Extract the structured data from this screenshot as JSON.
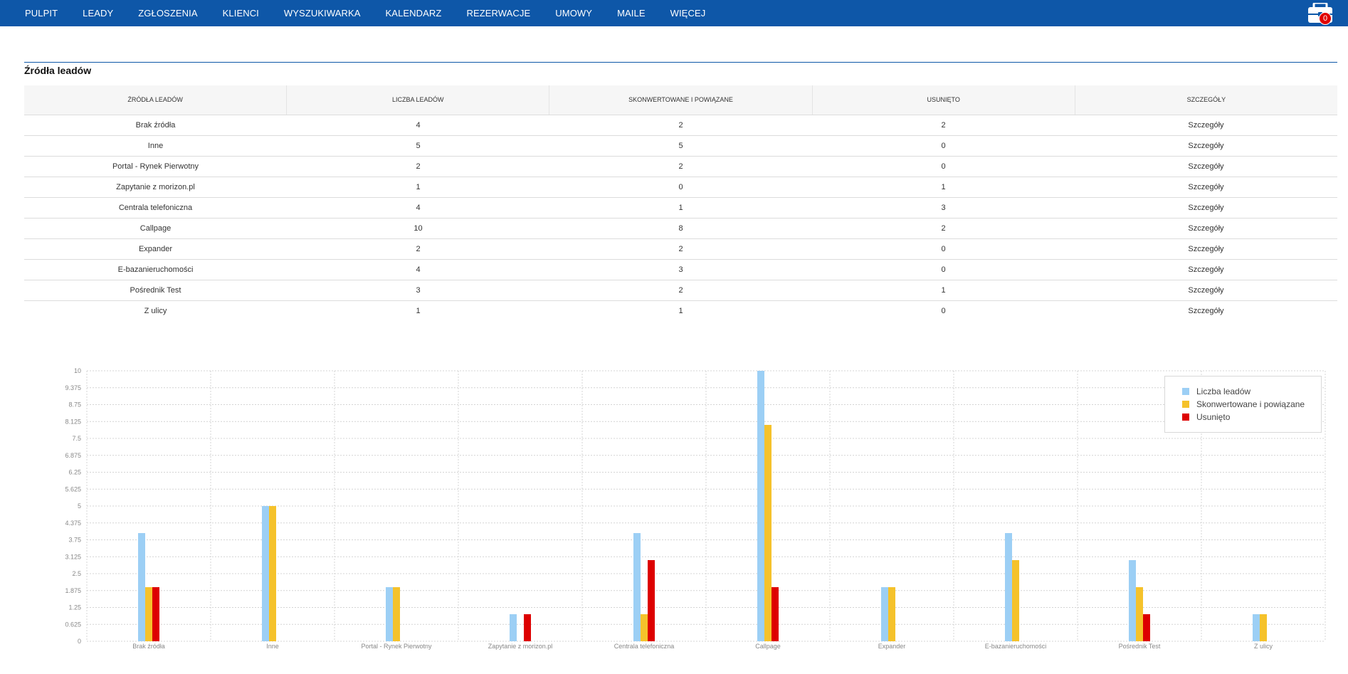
{
  "nav": {
    "items": [
      "PULPIT",
      "LEADY",
      "ZGŁOSZENIA",
      "KLIENCI",
      "WYSZUKIWARKA",
      "KALENDARZ",
      "REZERWACJE",
      "UMOWY",
      "MAILE",
      "WIĘCEJ"
    ],
    "cart_count": "0",
    "icon": "briefcase-icon"
  },
  "section": {
    "title": "Źródła leadów"
  },
  "table": {
    "headers": [
      "ŹRÓDŁA LEADÓW",
      "LICZBA LEADÓW",
      "SKONWERTOWANE I POWIĄZANE",
      "USUNIĘTO",
      "SZCZEGÓŁY"
    ],
    "rows": [
      [
        "Brak źródła",
        "4",
        "2",
        "2",
        "Szczegóły"
      ],
      [
        "Inne",
        "5",
        "5",
        "0",
        "Szczegóły"
      ],
      [
        "Portal - Rynek Pierwotny",
        "2",
        "2",
        "0",
        "Szczegóły"
      ],
      [
        "Zapytanie z morizon.pl",
        "1",
        "0",
        "1",
        "Szczegóły"
      ],
      [
        "Centrala telefoniczna",
        "4",
        "1",
        "3",
        "Szczegóły"
      ],
      [
        "Callpage",
        "10",
        "8",
        "2",
        "Szczegóły"
      ],
      [
        "Expander",
        "2",
        "2",
        "0",
        "Szczegóły"
      ],
      [
        "E-bazanieruchomości",
        "4",
        "3",
        "0",
        "Szczegóły"
      ],
      [
        "Pośrednik Test",
        "3",
        "2",
        "1",
        "Szczegóły"
      ],
      [
        "Z ulicy",
        "1",
        "1",
        "0",
        "Szczegóły"
      ]
    ]
  },
  "chart_data": {
    "type": "bar",
    "categories": [
      "Brak źródła",
      "Inne",
      "Portal - Rynek Pierwotny",
      "Zapytanie z morizon.pl",
      "Centrala telefoniczna",
      "Callpage",
      "Expander",
      "E-bazanieruchomości",
      "Pośrednik Test",
      "Z ulicy"
    ],
    "series": [
      {
        "name": "Liczba leadów",
        "color": "#9ccff5",
        "values": [
          4,
          5,
          2,
          1,
          4,
          10,
          2,
          4,
          3,
          1
        ]
      },
      {
        "name": "Skonwertowane i powiązane",
        "color": "#f5c22b",
        "values": [
          2,
          5,
          2,
          0,
          1,
          8,
          2,
          3,
          2,
          1
        ]
      },
      {
        "name": "Usunięto",
        "color": "#dd0000",
        "values": [
          2,
          0,
          0,
          1,
          3,
          2,
          0,
          0,
          1,
          0
        ]
      }
    ],
    "yticks": [
      "0",
      "0.625",
      "1.25",
      "1.875",
      "2.5",
      "3.125",
      "3.75",
      "4.375",
      "5",
      "5.625",
      "6.25",
      "6.875",
      "7.5",
      "8.125",
      "8.75",
      "9.375",
      "10"
    ],
    "ylim": [
      0,
      10
    ],
    "grid": true,
    "legend_position": "top-right",
    "title": "",
    "xlabel": "",
    "ylabel": ""
  }
}
